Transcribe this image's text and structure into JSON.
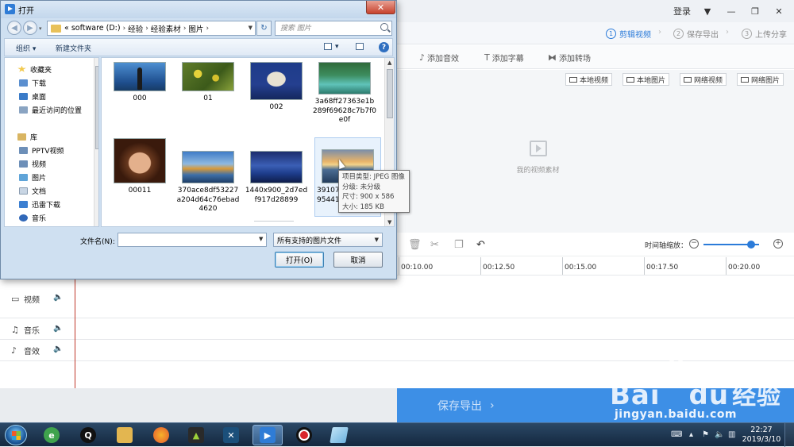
{
  "app": {
    "login": "登录",
    "steps": [
      {
        "num": "1",
        "label": "剪辑视频"
      },
      {
        "num": "2",
        "label": "保存导出"
      },
      {
        "num": "3",
        "label": "上传分享"
      }
    ],
    "toolbar": [
      "添加音效",
      "添加字幕",
      "添加转场"
    ],
    "media_buttons": [
      "本地视频",
      "本地图片",
      "网络视频",
      "网络图片"
    ],
    "empty_label": "我的视频素材",
    "zoom_label": "时间轴缩放：",
    "zoom_level": 0.85,
    "ruler_ticks": [
      "00:10.00",
      "00:12.50",
      "00:15.00",
      "00:17.50",
      "00:20.00"
    ],
    "tracks": [
      {
        "icon": "video-camera-icon",
        "label": "视频"
      },
      {
        "icon": "music-note-icon",
        "label": "音乐"
      },
      {
        "icon": "sound-effect-icon",
        "label": "音效"
      }
    ],
    "export_label": "保存导出",
    "export_chevron": "›"
  },
  "dialog": {
    "title": "打开",
    "breadcrumb": [
      "software (D:)",
      "经验",
      "经验素材",
      "图片"
    ],
    "breadcrumb_prefix": "«",
    "search_placeholder": "搜索 图片",
    "organize": "组织 ▾",
    "new_folder": "新建文件夹",
    "nav": {
      "favorites": "收藏夹",
      "favorites_items": [
        "下载",
        "桌面",
        "最近访问的位置"
      ],
      "library": "库",
      "library_items": [
        "PPTV视频",
        "视频",
        "图片",
        "文档",
        "迅雷下载",
        "音乐"
      ]
    },
    "files": [
      {
        "name": "000"
      },
      {
        "name": "01"
      },
      {
        "name": "002"
      },
      {
        "name": "3a68ff27363e1b289f69628c7b7f0e0f"
      },
      {
        "name": "00011"
      },
      {
        "name": "370ace8df53227a204d64c76ebad4620"
      },
      {
        "name": "1440x900_2d7edf917d28899"
      },
      {
        "name": "39107"
      },
      {
        "name": "95441"
      }
    ],
    "tooltip": [
      "项目类型: JPEG 图像",
      "分级: 未分级",
      "尺寸: 900 x 586",
      "大小: 185 KB"
    ],
    "filename_label": "文件名(N):",
    "filename_value": "",
    "filetype": "所有支持的图片文件",
    "open_button": "打开(O)",
    "cancel_button": "取消"
  },
  "taskbar": {
    "clock_time": "22:27",
    "clock_date": "2019/3/10"
  },
  "watermark": {
    "logo_a": "Bai",
    "logo_b": "du",
    "logo_c": "经验",
    "url": "jingyan.baidu.com"
  }
}
